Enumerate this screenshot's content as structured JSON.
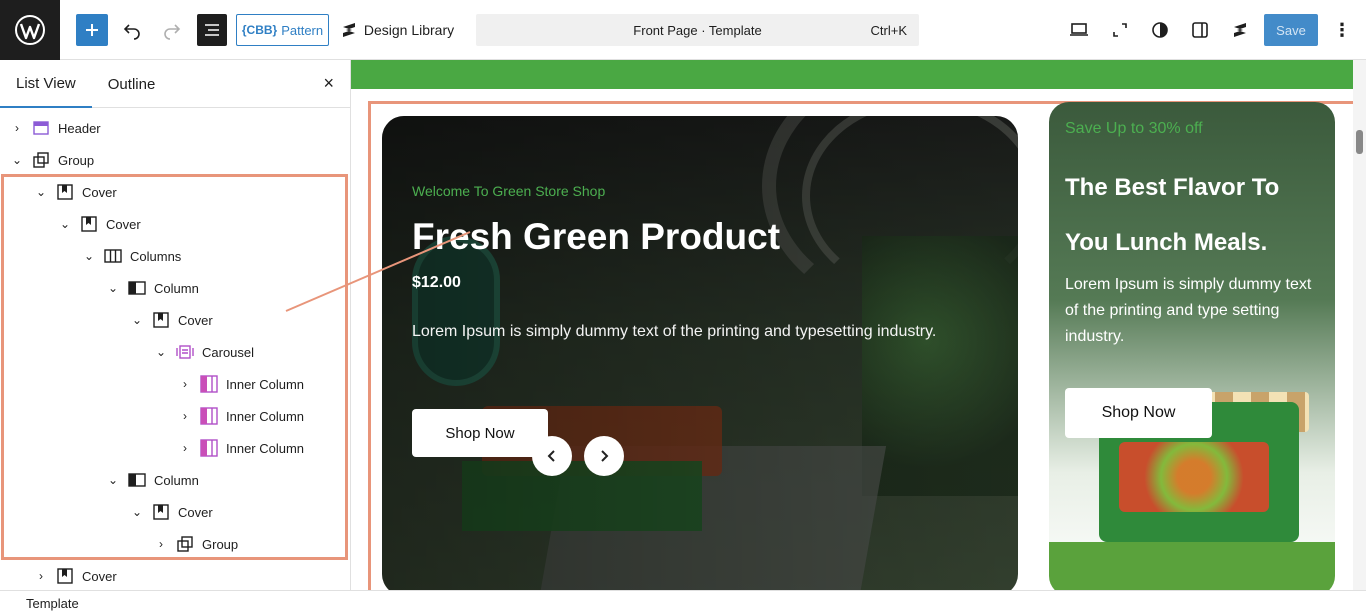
{
  "toolbar": {
    "pattern_label": "Pattern",
    "pattern_badge": "{CBB}",
    "design_library_label": "Design Library",
    "command_title": "Front Page · Template",
    "command_shortcut": "Ctrl+K",
    "save_label": "Save",
    "more_label": "⋮"
  },
  "sidebar": {
    "tabs": [
      "List View",
      "Outline"
    ],
    "close": "×",
    "tree": [
      {
        "label": "Header",
        "icon": "template-part-icon",
        "chevron": "›"
      },
      {
        "label": "Group",
        "icon": "group-icon",
        "chevron": "⌄"
      },
      {
        "label": "Cover",
        "icon": "cover-icon",
        "chevron": "⌄"
      },
      {
        "label": "Cover",
        "icon": "cover-icon",
        "chevron": "⌄"
      },
      {
        "label": "Columns",
        "icon": "columns-icon",
        "chevron": "⌄"
      },
      {
        "label": "Column",
        "icon": "column-icon",
        "chevron": "⌄"
      },
      {
        "label": "Cover",
        "icon": "cover-icon",
        "chevron": "⌄"
      },
      {
        "label": "Carousel",
        "icon": "carousel-icon",
        "chevron": "⌄"
      },
      {
        "label": "Inner Column",
        "icon": "inner-column-icon",
        "chevron": "›"
      },
      {
        "label": "Inner Column",
        "icon": "inner-column-icon",
        "chevron": "›"
      },
      {
        "label": "Inner Column",
        "icon": "inner-column-icon",
        "chevron": "›"
      },
      {
        "label": "Column",
        "icon": "column-icon",
        "chevron": "⌄"
      },
      {
        "label": "Cover",
        "icon": "cover-icon",
        "chevron": "⌄"
      },
      {
        "label": "Group",
        "icon": "group-icon",
        "chevron": "›"
      },
      {
        "label": "Cover",
        "icon": "cover-icon",
        "chevron": "›"
      }
    ]
  },
  "status": {
    "label": "Template"
  },
  "hero": {
    "subtitle": "Welcome To Green Store Shop",
    "title": "Fresh Green Product",
    "price": "$12.00",
    "text": "Lorem Ipsum is simply dummy text of the printing and typesetting industry.",
    "button": "Shop Now",
    "prev": "‹",
    "next": "›"
  },
  "side": {
    "subtitle": "Save Up to 30% off",
    "title": "The Best Flavor To You Lunch Meals.",
    "text": "Lorem Ipsum is simply dummy text of the printing and type setting industry.",
    "button": "Shop Now"
  },
  "colors": {
    "accent": "#2f7fc4",
    "highlight": "#e8957a",
    "green": "#4aa843"
  }
}
